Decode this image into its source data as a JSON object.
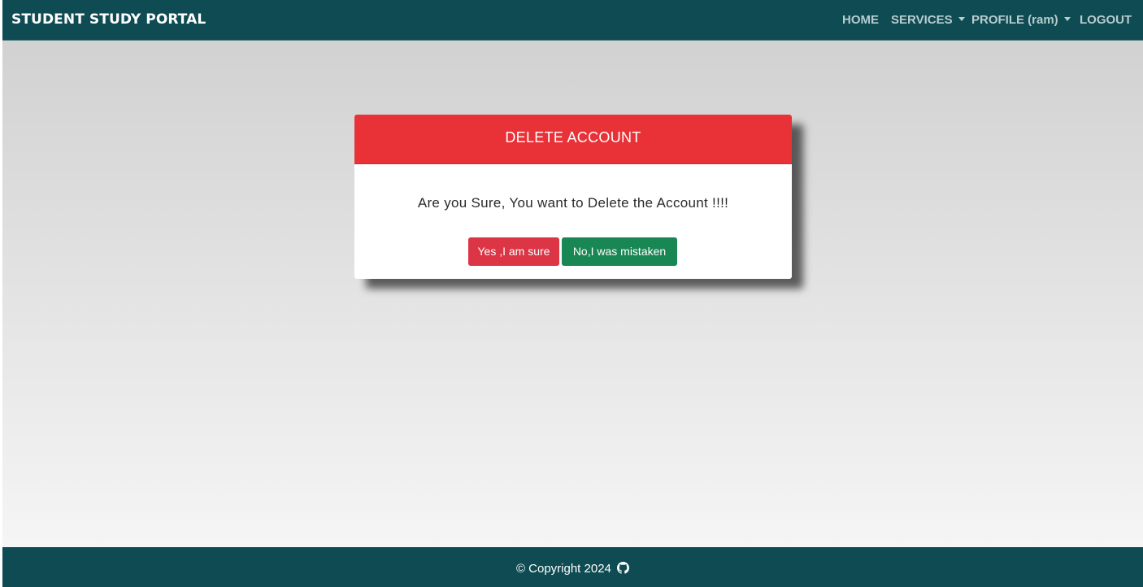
{
  "navbar": {
    "brand": "STUDENT STUDY PORTAL",
    "items": [
      {
        "label": "HOME"
      },
      {
        "label": "SERVICES",
        "has_dropdown": true
      },
      {
        "label": "PROFILE (ram)",
        "has_dropdown": true
      },
      {
        "label": "LOGOUT"
      }
    ]
  },
  "dialog": {
    "title": "DELETE ACCOUNT",
    "message": "Are you Sure, You want to Delete the Account !!!!",
    "confirm_label": "Yes ,I am sure",
    "cancel_label": "No,I was mistaken"
  },
  "footer": {
    "copyright": "© Copyright 2024",
    "icon": "github-icon"
  },
  "colors": {
    "navbar_bg": "#0e4b52",
    "header_red": "#e83238",
    "danger": "#dc3545",
    "success": "#198754"
  }
}
